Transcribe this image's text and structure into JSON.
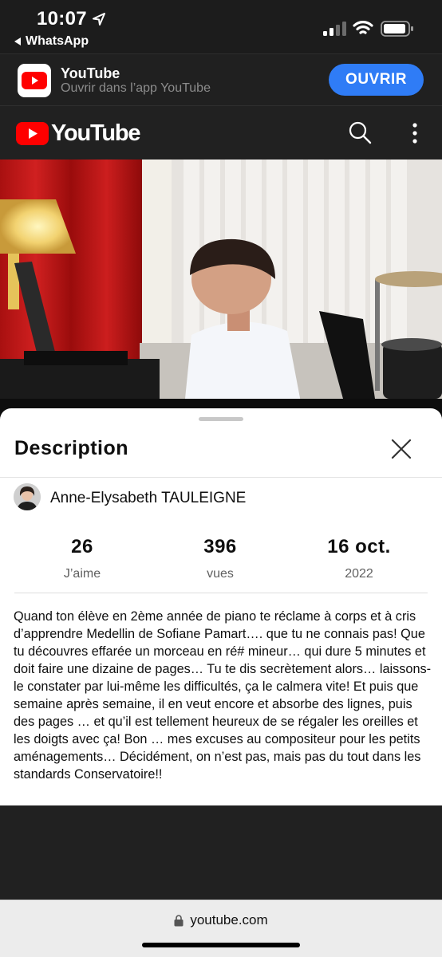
{
  "status_bar": {
    "time": "10:07",
    "back_app": "WhatsApp",
    "icons": [
      "location-arrow-icon",
      "signal-icon",
      "wifi-icon",
      "battery-icon"
    ]
  },
  "app_banner": {
    "title": "YouTube",
    "subtitle": "Ouvrir dans l’app YouTube",
    "open_label": "OUVRIR",
    "accent_color": "#2f7cf6"
  },
  "yt_header": {
    "logo_text": "YouTube",
    "brand_color": "#ff0000",
    "icons": [
      "search-icon",
      "more-vert-icon"
    ]
  },
  "description_panel": {
    "title": "Description",
    "channel_name": "Anne-Elysabeth TAULEIGNE",
    "stats": [
      {
        "value": "26",
        "label": "J’aime"
      },
      {
        "value": "396",
        "label": "vues"
      },
      {
        "value": "16 oct.",
        "label": "2022"
      }
    ],
    "text": "Quand ton élève en 2ème année de piano te réclame à corps et à cris d’apprendre Medellin de Sofiane Pamart…. que tu ne connais pas! Que tu découvres effarée un morceau en ré# mineur… qui dure 5 minutes et doit faire une dizaine de pages… Tu te dis secrètement alors… laissons-le constater par lui-même les difficultés, ça le calmera vite! Et puis que semaine après semaine, il en veut encore et absorbe des lignes, puis des pages … et qu’il est tellement heureux de se régaler les oreilles et les doigts avec ça! Bon … mes excuses au compositeur pour les petits aménagements… Décidément, on n’est pas, mais pas du tout dans les standards Conservatoire!!"
  },
  "browser": {
    "url": "youtube.com"
  }
}
